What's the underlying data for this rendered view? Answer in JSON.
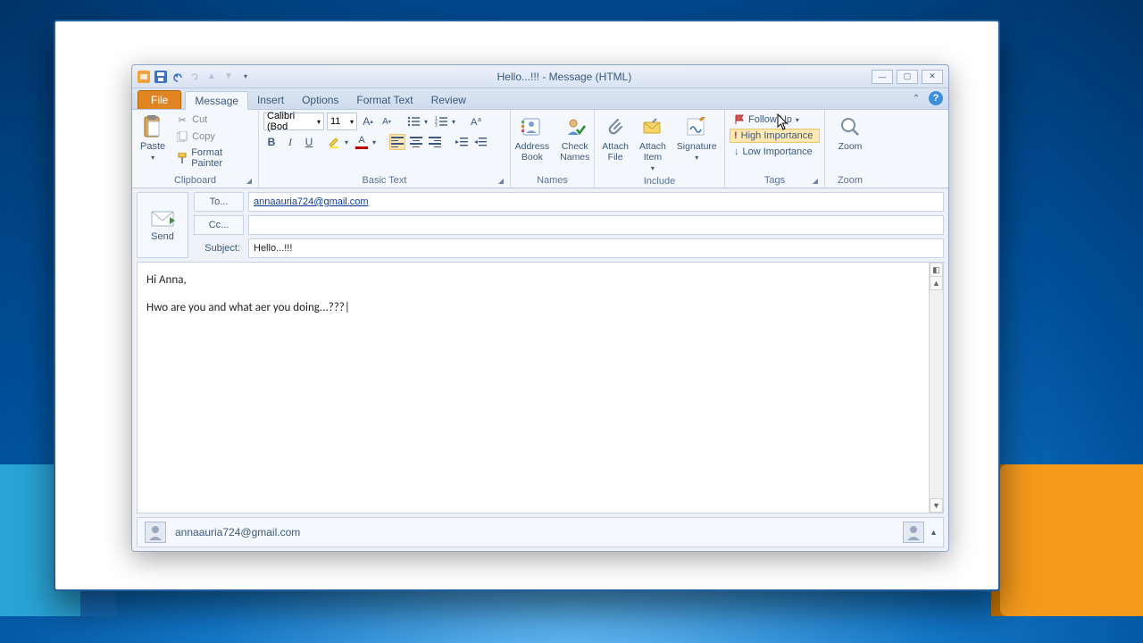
{
  "window": {
    "title": "Hello...!!!  -  Message (HTML)"
  },
  "qat": {
    "save_tooltip": "Save",
    "undo_tooltip": "Undo",
    "redo_tooltip": "Redo"
  },
  "tabs": {
    "file": "File",
    "message": "Message",
    "insert": "Insert",
    "options": "Options",
    "format_text": "Format Text",
    "review": "Review"
  },
  "ribbon": {
    "clipboard": {
      "paste": "Paste",
      "cut": "Cut",
      "copy": "Copy",
      "format_painter": "Format Painter",
      "group": "Clipboard"
    },
    "basic_text": {
      "font": "Calibri (Bod",
      "size": "11",
      "group": "Basic Text"
    },
    "names": {
      "address_book": "Address\nBook",
      "check_names": "Check\nNames",
      "group": "Names"
    },
    "include": {
      "attach_file": "Attach\nFile",
      "attach_item": "Attach\nItem",
      "signature": "Signature",
      "group": "Include"
    },
    "tags": {
      "follow_up": "Follow Up",
      "high": "High Importance",
      "low": "Low Importance",
      "group": "Tags"
    },
    "zoom": {
      "zoom": "Zoom",
      "group": "Zoom"
    }
  },
  "compose": {
    "send": "Send",
    "to_label": "To...",
    "cc_label": "Cc...",
    "subject_label": "Subject:",
    "to_value": "annaauria724@gmail.com",
    "cc_value": "",
    "subject_value": "Hello...!!!",
    "body_line1": "Hi Anna,",
    "body_line2": "Hwo are you and what aer you doing...???"
  },
  "people_pane": {
    "email": "annaauria724@gmail.com"
  }
}
